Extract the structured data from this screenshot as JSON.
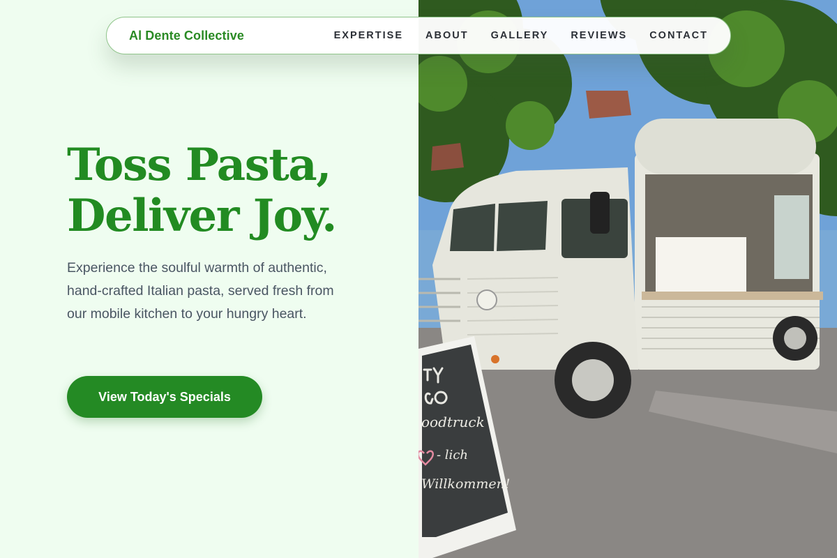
{
  "nav": {
    "brand": "Al Dente Collective",
    "links": [
      "EXPERTISE",
      "ABOUT",
      "GALLERY",
      "REVIEWS",
      "CONTACT"
    ]
  },
  "hero": {
    "headline_line1": "Toss Pasta,",
    "headline_line2": "Deliver Joy.",
    "lead": "Experience the soulful warmth of authentic, hand-crafted Italian pasta, served fresh from our mobile kitchen to your hungry heart.",
    "cta_label": "View Today's Specials"
  },
  "photo": {
    "alt": "Vintage white food truck parked on a street with a chalkboard sign",
    "sign_lines": [
      "HY",
      "GO",
      "foodtruck",
      "♥-lich",
      "Willkommen!"
    ]
  },
  "colors": {
    "accent": "#228b22",
    "background": "#effdf0",
    "text_dark": "#2b2f36",
    "text_muted": "#4a5663"
  }
}
